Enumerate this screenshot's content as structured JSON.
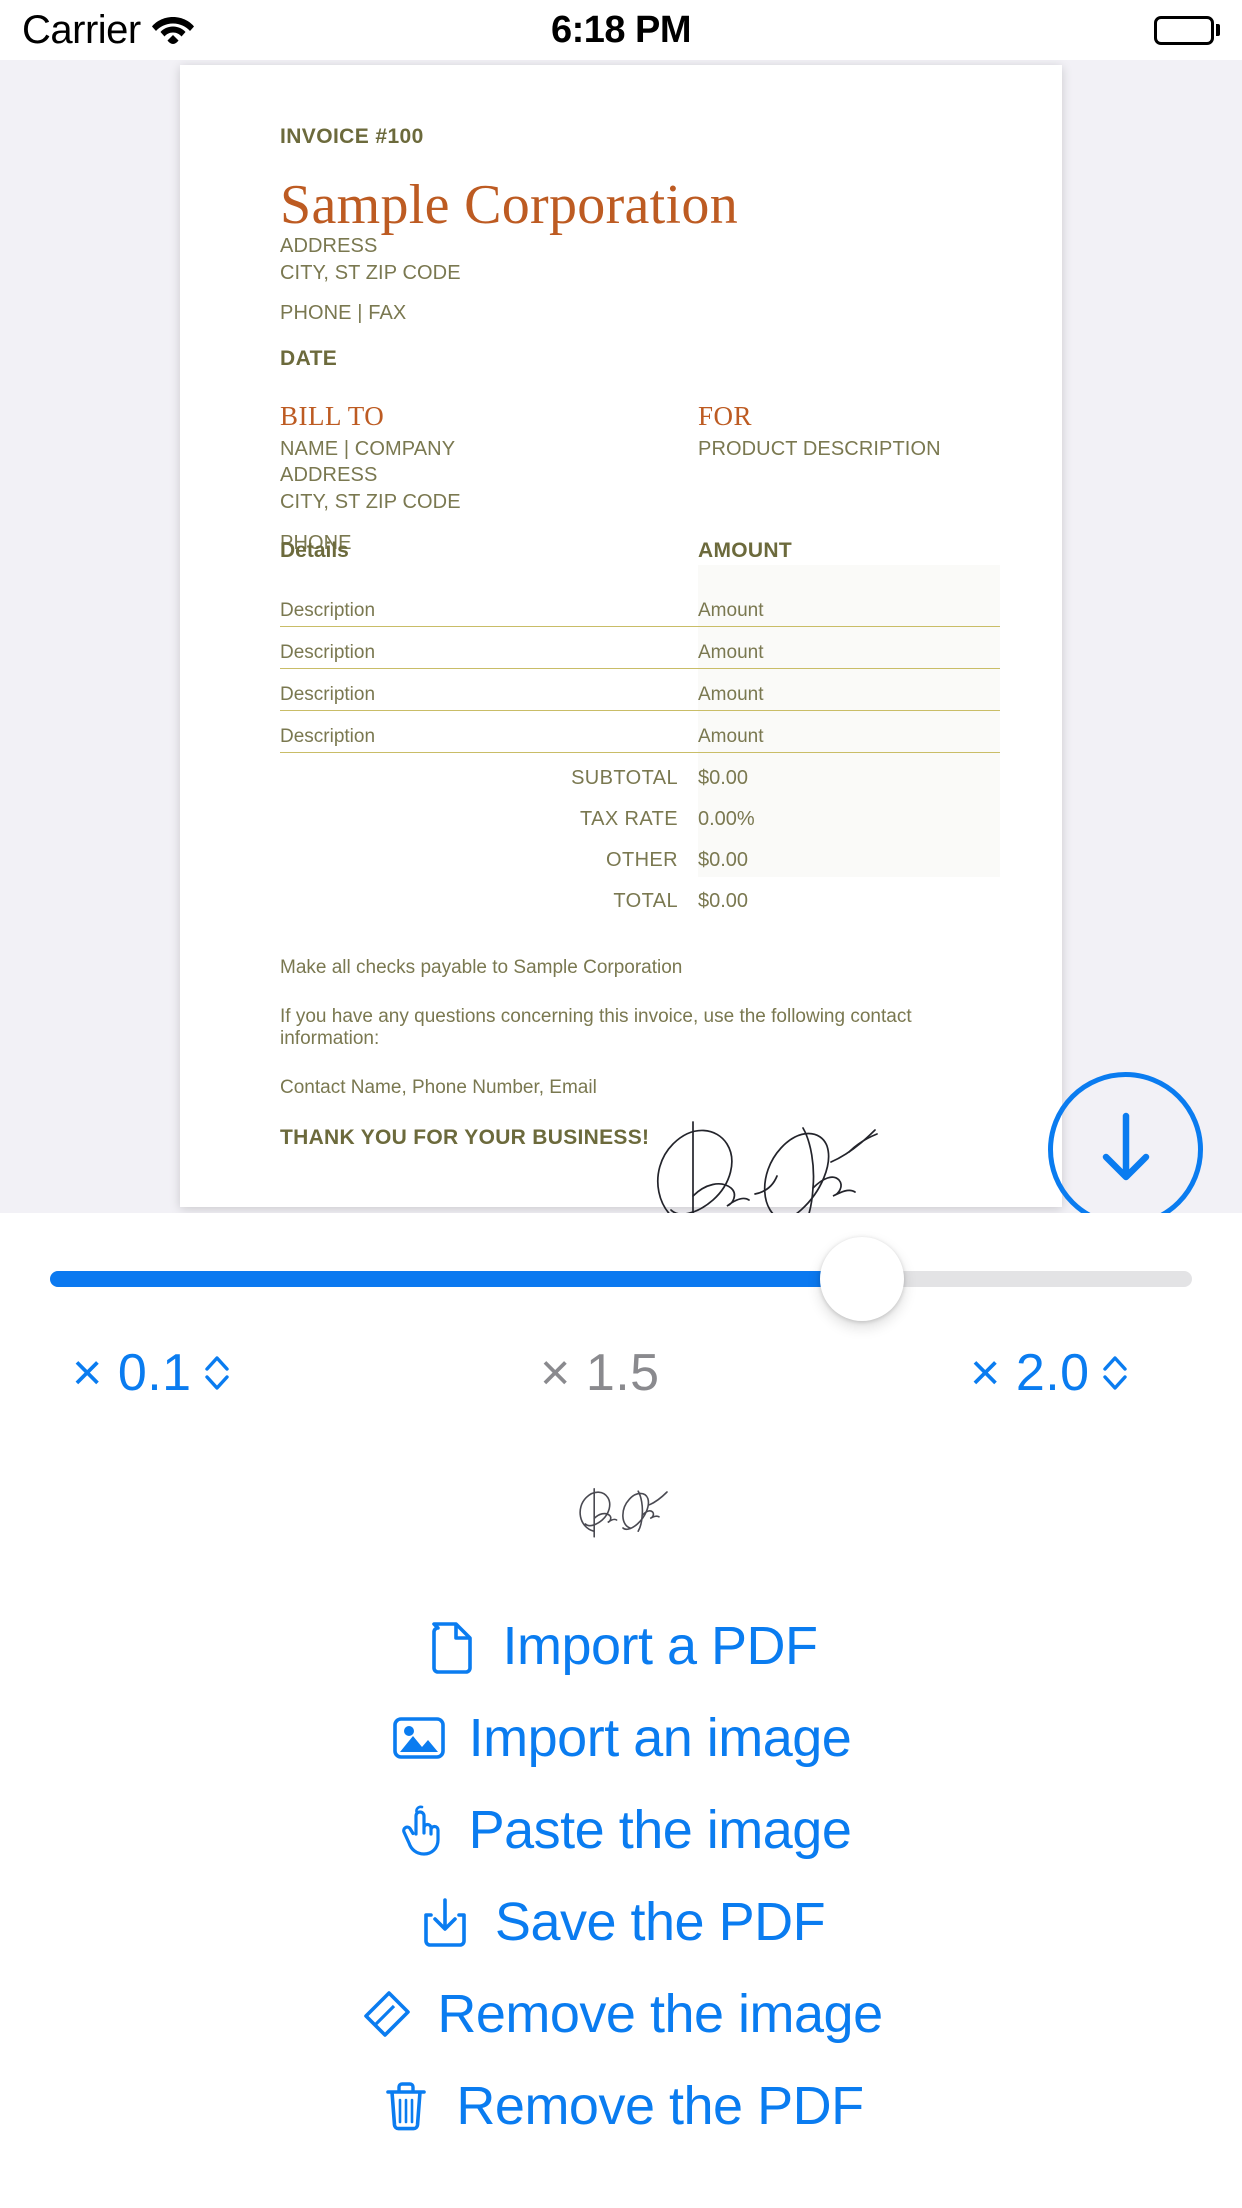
{
  "status_bar": {
    "carrier": "Carrier",
    "wifi_icon": "wifi-icon",
    "time": "6:18 PM",
    "battery_icon": "battery-full-icon"
  },
  "viewer": {
    "download_button_icon": "download-arrow-icon",
    "accent_color": "#0a7cf0",
    "background_color": "#f2f1f6"
  },
  "invoice": {
    "invoice_number": "INVOICE #100",
    "company": "Sample Corporation",
    "company_color": "#bd5b22",
    "label_color": "#6c6a3c",
    "address_lines": [
      "ADDRESS",
      "CITY, ST ZIP CODE"
    ],
    "phone_fax": "PHONE | FAX",
    "date_label": "DATE",
    "bill_to": {
      "heading": "BILL TO",
      "lines": [
        "NAME | COMPANY",
        "ADDRESS",
        "CITY, ST ZIP CODE"
      ],
      "phone": "PHONE"
    },
    "for": {
      "heading": "FOR",
      "description": "PRODUCT DESCRIPTION"
    },
    "table": {
      "header_details": "Details",
      "header_amount": "AMOUNT",
      "rows": [
        {
          "description": "Description",
          "amount": "Amount"
        },
        {
          "description": "Description",
          "amount": "Amount"
        },
        {
          "description": "Description",
          "amount": "Amount"
        },
        {
          "description": "Description",
          "amount": "Amount"
        }
      ],
      "rule_color": "#c9bd67"
    },
    "totals": [
      {
        "label": "SUBTOTAL",
        "value": "$0.00"
      },
      {
        "label": "TAX RATE",
        "value": "0.00%"
      },
      {
        "label": "OTHER",
        "value": "$0.00"
      },
      {
        "label": "TOTAL",
        "value": "$0.00"
      }
    ],
    "notes": [
      "Make all checks payable to Sample Corporation",
      "If you have any questions concerning this invoice, use the following contact information:",
      "Contact Name, Phone Number, Email"
    ],
    "thank_you": "THANK YOU FOR YOUR BUSINESS!",
    "signature_overlay": "handwritten-signature"
  },
  "zoom_slider": {
    "fill_percent": 70,
    "fill_color": "#0b79f0",
    "track_color": "#e3e3e5"
  },
  "zoom_controls": {
    "min": {
      "label": "× 0.1",
      "color": "#0a7cf0",
      "stepper": true
    },
    "current": {
      "label": "× 1.5",
      "color": "#8a8a8e",
      "stepper": false
    },
    "max": {
      "label": "× 2.0",
      "color": "#0a7cf0",
      "stepper": true
    }
  },
  "preview": {
    "thumbnail": "signature-thumbnail"
  },
  "actions": [
    {
      "label": "Import a PDF",
      "icon": "document-icon"
    },
    {
      "label": "Import an image",
      "icon": "photo-icon"
    },
    {
      "label": "Paste the image",
      "icon": "hand-pointer-icon"
    },
    {
      "label": "Save the PDF",
      "icon": "save-download-icon"
    },
    {
      "label": "Remove the image",
      "icon": "eraser-icon"
    },
    {
      "label": "Remove the PDF",
      "icon": "trash-icon"
    }
  ]
}
